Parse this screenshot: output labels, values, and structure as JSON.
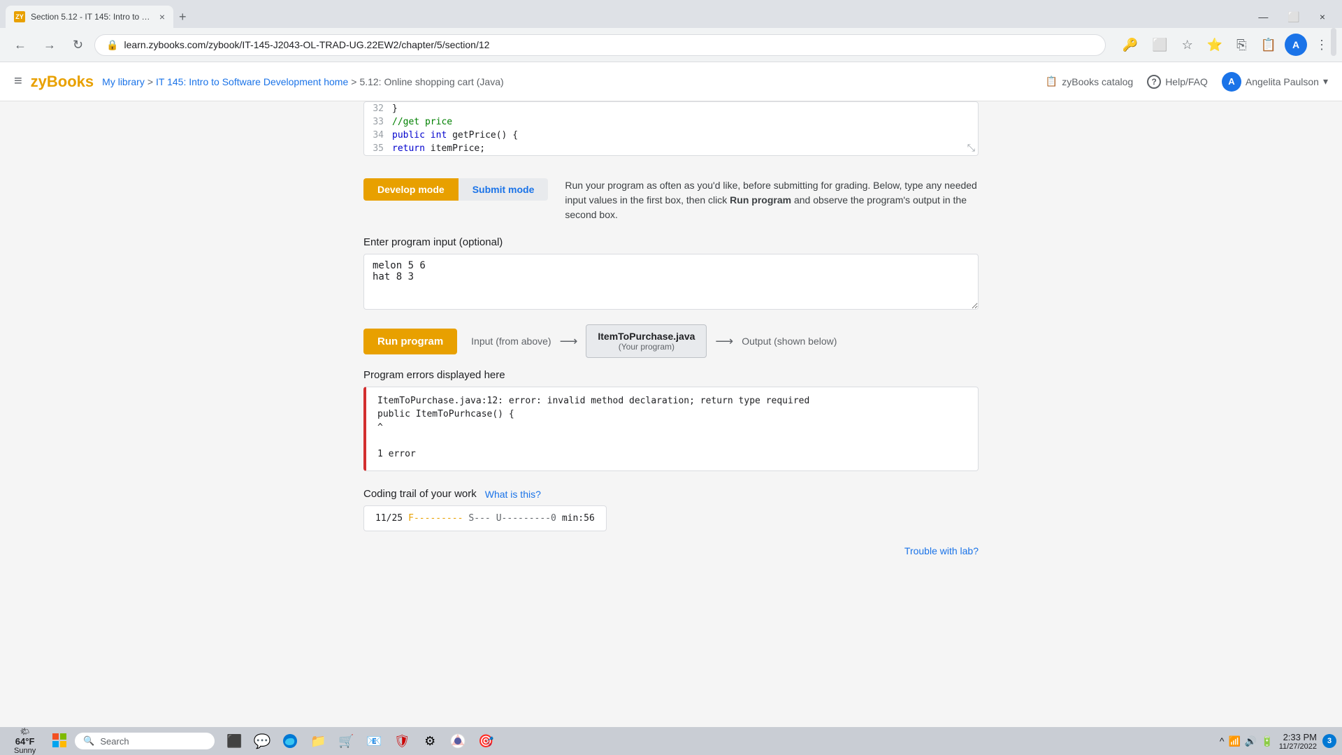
{
  "browser": {
    "tab": {
      "favicon": "ZY",
      "title": "Section 5.12 - IT 145: Intro to So...",
      "close": "×"
    },
    "tab_new": "+",
    "tab_controls": [
      "⌄",
      "⬜",
      "×"
    ],
    "nav": {
      "back": "←",
      "forward": "→",
      "refresh": "↻",
      "url": "learn.zybooks.com/zybook/IT-145-J2043-OL-TRAD-UG.22EW2/chapter/5/section/12"
    },
    "browser_actions": [
      "🔑",
      "⭐",
      "⭐",
      "⎘",
      "📋",
      "A"
    ]
  },
  "app": {
    "logo": "zyBooks",
    "menu_icon": "≡",
    "breadcrumb": {
      "library": "My library",
      "sep1": ">",
      "course": "IT 145: Intro to Software Development home",
      "sep2": ">",
      "section": "5.12: Online shopping cart (Java)"
    },
    "header_actions": {
      "catalog_icon": "📋",
      "catalog_label": "zyBooks catalog",
      "help_icon": "?",
      "help_label": "Help/FAQ",
      "user_icon": "A",
      "user_name": "Angelita Paulson",
      "user_chevron": "▾"
    }
  },
  "code_editor": {
    "lines": [
      {
        "num": "32",
        "code": "   }"
      },
      {
        "num": "33",
        "code": "   //get price"
      },
      {
        "num": "34",
        "code": "   public int getPrice() {"
      },
      {
        "num": "35",
        "code": "      return itemPrice;"
      }
    ]
  },
  "mode": {
    "develop_label": "Develop mode",
    "submit_label": "Submit mode",
    "description": "Run your program as often as you'd like, before submitting for grading. Below, type any needed input values in the first box, then click Run program and observe the program's output in the second box."
  },
  "input_section": {
    "label": "Enter program input (optional)",
    "value": "melon 5 6\nhat 8 3"
  },
  "run_section": {
    "button_label": "Run program",
    "flow_input": "Input (from above)",
    "flow_program_title": "ItemToPurchase.java",
    "flow_program_sub": "(Your program)",
    "flow_output": "Output (shown below)"
  },
  "error_section": {
    "label": "Program errors displayed here",
    "lines": [
      "ItemToPurchase.java:12: error: invalid method declaration; return type required",
      "   public ItemToPurhcase() {",
      "          ^",
      "",
      "1 error"
    ]
  },
  "coding_trail": {
    "label": "Coding trail of your work",
    "what_is_this": "What is this?",
    "trail_date": "11/25",
    "trail_f": "F---------",
    "trail_s": "S---",
    "trail_u": "U---------0",
    "trail_time": "min:56"
  },
  "trouble_link": "Trouble with lab?",
  "taskbar": {
    "weather": {
      "temp": "64°F",
      "condition": "Sunny",
      "icon": "🌤"
    },
    "start_icon": "⊞",
    "search": {
      "icon": "🔍",
      "label": "Search"
    },
    "icons": [
      "⬛",
      "💬",
      "🌐",
      "📁",
      "🛒",
      "📧",
      "🛡",
      "⚙",
      "🌐",
      "🎯"
    ],
    "sys_icons": [
      "^",
      "💬",
      "🔊",
      "📶",
      "🔋"
    ],
    "time": "2:33 PM",
    "date": "11/27/2022",
    "notification_badge": "3"
  }
}
